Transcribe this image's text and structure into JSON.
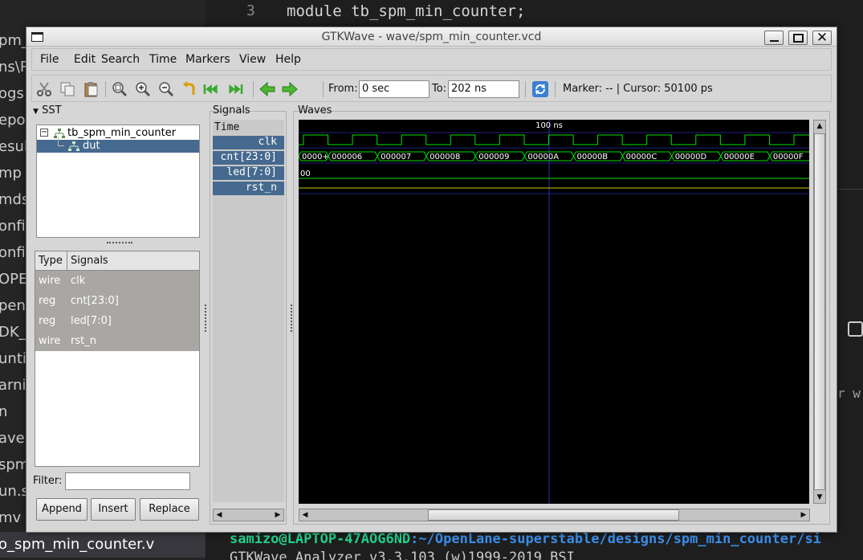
{
  "background": {
    "sidebar_items": [
      "pm_",
      "ns\\R",
      "ogs",
      "epor",
      "esult",
      "mp",
      "mds",
      "onfig",
      "onfig",
      "OPEN",
      "pen",
      "DK_",
      "untin",
      "arni",
      "n",
      "ave",
      "spm",
      "un.s",
      "mv",
      "o_spm_min_counter.v"
    ],
    "editor": {
      "line_number": "3",
      "code": "module tb_spm_min_counter;"
    },
    "right_partial_text": "r w",
    "terminal": {
      "user_host": "samizo@LAPTOP-47AOG6ND",
      "path": ":~/OpenLane-superstable/designs/spm_min_counter/si",
      "line2": "GTKWave Analyzer v3.3.103 (w)1999-2019 BSI"
    }
  },
  "window": {
    "title": "GTKWave - wave/spm_min_counter.vcd",
    "menu": [
      "File",
      "Edit",
      "Search",
      "Time",
      "Markers",
      "View",
      "Help"
    ],
    "toolbar": {
      "icons": [
        "cut-icon",
        "copy-icon",
        "paste-icon",
        "zoom-fit-icon",
        "zoom-in-icon",
        "zoom-out-icon",
        "undo-zoom-icon",
        "zoom-start-icon",
        "zoom-end-icon",
        "prev-edge-icon",
        "next-edge-icon",
        "reload-icon"
      ],
      "from_label": "From:",
      "from_value": "0 sec",
      "to_label": "To:",
      "to_value": "202 ns",
      "marker_text": "Marker: --  |  Cursor: 50100 ps"
    },
    "sst": {
      "header": "SST",
      "tree": [
        {
          "label": "tb_spm_min_counter",
          "selected": false
        },
        {
          "label": "dut",
          "selected": true
        }
      ],
      "columns": [
        "Type",
        "Signals"
      ],
      "rows": [
        {
          "type": "wire",
          "signal": "clk"
        },
        {
          "type": "reg",
          "signal": "cnt[23:0]"
        },
        {
          "type": "reg",
          "signal": "led[7:0]"
        },
        {
          "type": "wire",
          "signal": "rst_n"
        }
      ],
      "filter_label": "Filter:",
      "buttons": [
        "Append",
        "Insert",
        "Replace"
      ]
    },
    "signals": {
      "header": "Signals",
      "time_label": "Time",
      "names": [
        "clk",
        "cnt[23:0]",
        "led[7:0]",
        "rst_n"
      ]
    },
    "waves": {
      "header": "Waves",
      "marker_label": "100 ns",
      "cnt_values": [
        "0000+",
        "000006",
        "000007",
        "000008",
        "000009",
        "00000A",
        "00000B",
        "00000C",
        "00000D",
        "00000E",
        "00000F"
      ],
      "led_value": "00",
      "colors": {
        "trace": "#00e000",
        "cursor": "#2d2db0",
        "rst": "#c8c800",
        "grid": "#202080",
        "label": "#ffffff"
      }
    }
  }
}
